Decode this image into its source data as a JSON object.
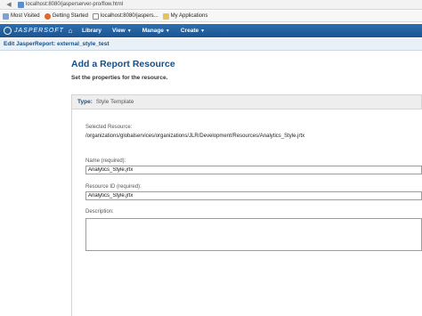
{
  "browser": {
    "url": "localhost:8080/jasperserver-pro/flow.html",
    "bookmarks": [
      {
        "label": "Most Visited",
        "icon": "most-visited-icon"
      },
      {
        "label": "Getting Started",
        "icon": "getting-started-icon"
      },
      {
        "label": "localhost:8080/jaspers...",
        "icon": "page-icon"
      },
      {
        "label": "My Applications",
        "icon": "folder-icon"
      }
    ]
  },
  "nav": {
    "logo": "JASPERSOFT",
    "items": [
      {
        "label": "Library"
      },
      {
        "label": "View",
        "dropdown": true
      },
      {
        "label": "Manage",
        "dropdown": true
      },
      {
        "label": "Create",
        "dropdown": true
      }
    ]
  },
  "breadcrumb": "Edit JasperReport: external_style_test",
  "page": {
    "title": "Add a Report Resource",
    "subtitle": "Set the properties for the resource."
  },
  "type_bar": {
    "label": "Type:",
    "value": "Style Template"
  },
  "form": {
    "selected_resource_label": "Selected Resource:",
    "selected_resource_value": "/organizations/globalservices/organizations/JLR/Development/Resources/Analytics_Style.jrtx",
    "name_label": "Name (required):",
    "name_value": "Analytics_Style.jrtx",
    "resource_id_label": "Resource ID (required):",
    "resource_id_value": "Analytics_Style.jrtx",
    "description_label": "Description:",
    "description_value": ""
  }
}
